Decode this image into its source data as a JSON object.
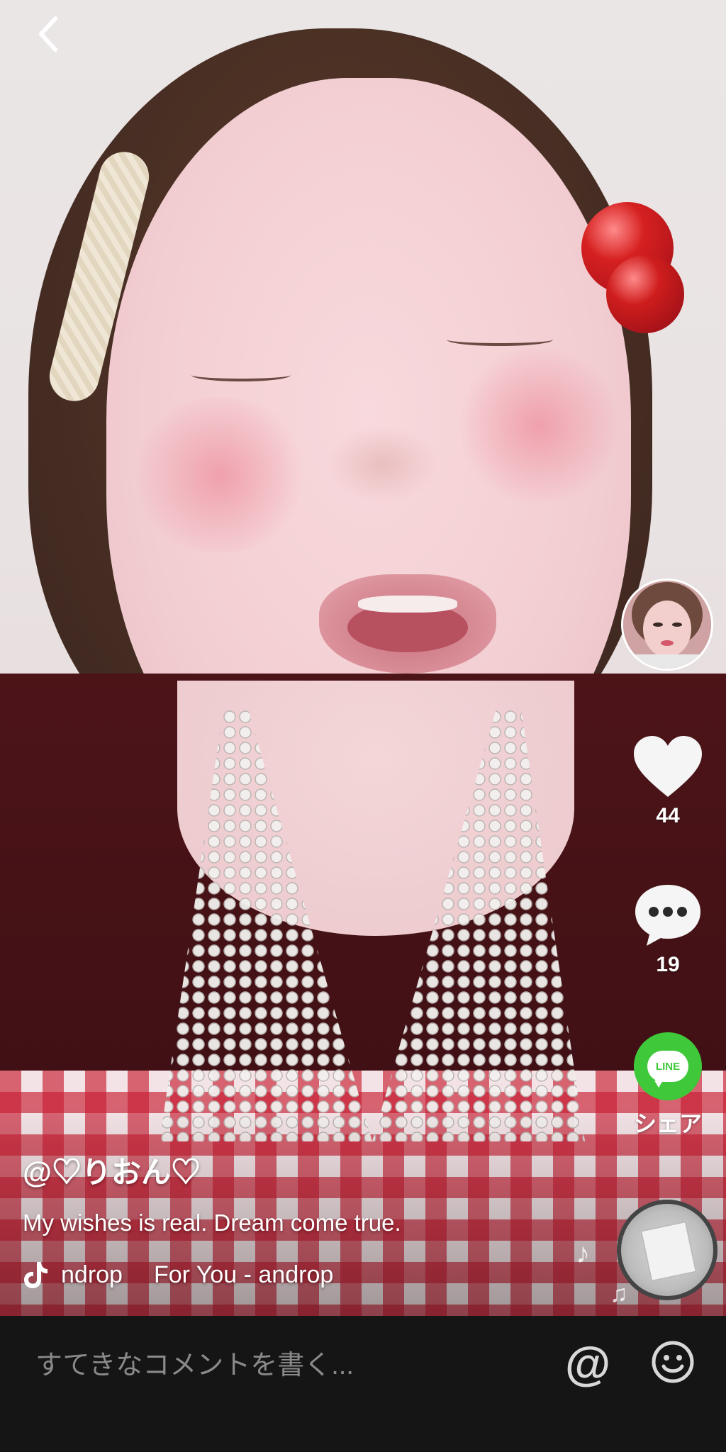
{
  "user": {
    "handle": "@♡りおん♡"
  },
  "video": {
    "caption": "My wishes is real. Dream come true."
  },
  "music": {
    "title_part1": "ndrop",
    "title_part2": "For You - androp"
  },
  "actions": {
    "likes": "44",
    "comments": "19",
    "share_label": "シェア",
    "line_text": "LINE"
  },
  "comment_bar": {
    "placeholder": "すてきなコメントを書く..."
  },
  "icons": {
    "back": "chevron-left-icon",
    "like": "heart-icon",
    "comment": "speech-bubble-icon",
    "share": "line-app-icon",
    "music": "tiktok-note-icon",
    "mention": "at-sign-icon",
    "emoji": "smiley-icon"
  }
}
